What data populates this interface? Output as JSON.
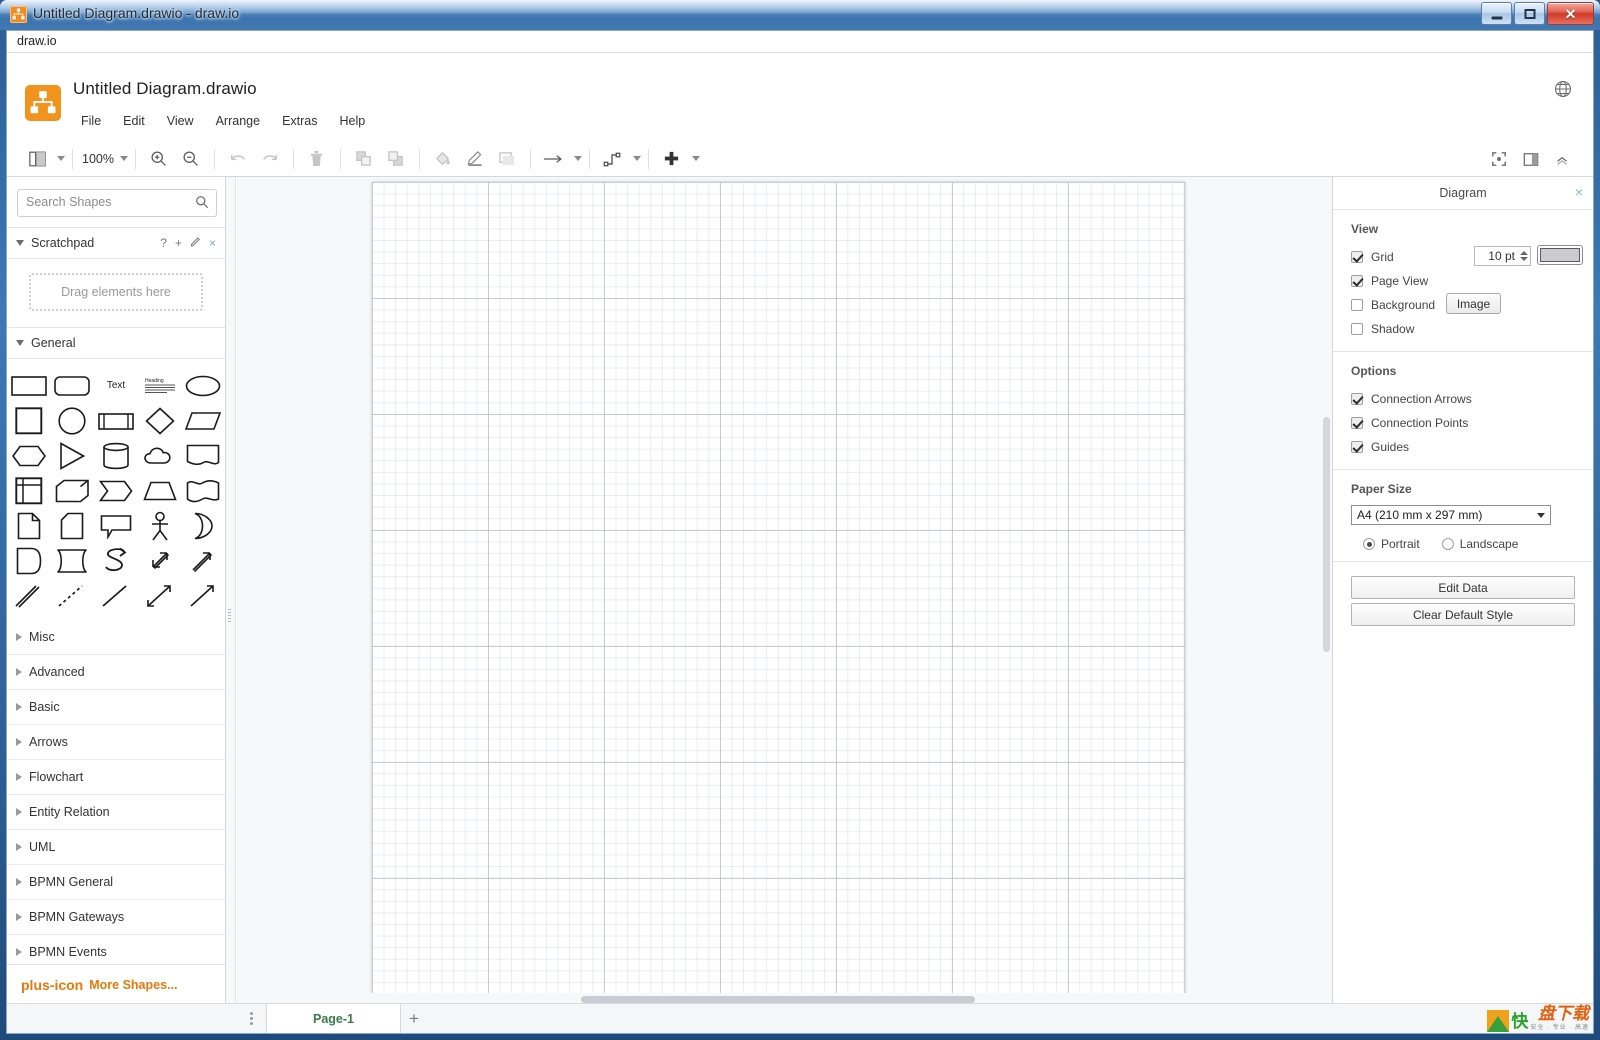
{
  "window": {
    "title": "Untitled Diagram.drawio - draw.io",
    "minimize_label": "Minimize",
    "maximize_label": "Maximize",
    "close_label": "✕"
  },
  "menustrip": {
    "label": "draw.io"
  },
  "header": {
    "app_title": "Untitled Diagram.drawio",
    "menus": [
      "File",
      "Edit",
      "View",
      "Arrange",
      "Extras",
      "Help"
    ],
    "language_icon": "globe-icon"
  },
  "toolbar": {
    "view_layers_icon": "view-layout-icon",
    "zoom_value": "100%",
    "zoom_in_icon": "zoom-in-icon",
    "zoom_out_icon": "zoom-out-icon",
    "undo_icon": "undo-icon",
    "redo_icon": "redo-icon",
    "delete_icon": "trash-icon",
    "to_front_icon": "bring-to-front-icon",
    "to_back_icon": "send-to-back-icon",
    "fill_icon": "fill-color-icon",
    "line_icon": "line-color-icon",
    "shadow_icon": "shadow-icon",
    "connection_icon": "connection-arrow-icon",
    "waypoints_icon": "waypoints-icon",
    "insert_icon": "insert-plus-icon",
    "fullscreen_icon": "fullscreen-icon",
    "format_panel_icon": "format-panel-icon",
    "collapse_icon": "collapse-chevrons-icon"
  },
  "sidebar": {
    "search": {
      "placeholder": "Search Shapes",
      "value": "",
      "icon": "search-icon"
    },
    "scratchpad": {
      "title": "Scratchpad",
      "help_icon": "?",
      "add_icon": "+",
      "edit_icon": "pencil-icon",
      "close_icon": "×",
      "dropzone_text": "Drag elements here"
    },
    "general": {
      "title": "General",
      "shapes": [
        "rectangle",
        "rounded-rectangle",
        "text",
        "textbox",
        "ellipse",
        "square",
        "circle",
        "process",
        "diamond",
        "parallelogram",
        "hexagon",
        "triangle",
        "cylinder",
        "cloud",
        "document",
        "internal-storage",
        "cube",
        "step",
        "trapezoid",
        "tape",
        "note",
        "card",
        "callout",
        "actor",
        "or",
        "data-storage",
        "delay",
        "s-curve",
        "double-arrow",
        "single-arrow",
        "double-line",
        "dashed-line",
        "line",
        "bidirectional-arrow",
        "arrow"
      ],
      "shapes_label_text": "Text",
      "shapes_label_textbox": "Heading"
    },
    "categories": [
      "Misc",
      "Advanced",
      "Basic",
      "Arrows",
      "Flowchart",
      "Entity Relation",
      "UML",
      "BPMN General",
      "BPMN Gateways",
      "BPMN Events"
    ],
    "more_shapes": "More Shapes...",
    "more_shapes_icon": "plus-icon"
  },
  "format_panel": {
    "title": "Diagram",
    "close_icon": "×",
    "view": {
      "heading": "View",
      "grid": {
        "label": "Grid",
        "checked": true,
        "size_value": "10 pt",
        "color": "#ccccd0"
      },
      "page_view": {
        "label": "Page View",
        "checked": true
      },
      "background": {
        "label": "Background",
        "checked": false,
        "button": "Image"
      },
      "shadow": {
        "label": "Shadow",
        "checked": false
      }
    },
    "options": {
      "heading": "Options",
      "items": [
        {
          "label": "Connection Arrows",
          "checked": true
        },
        {
          "label": "Connection Points",
          "checked": true
        },
        {
          "label": "Guides",
          "checked": true
        }
      ]
    },
    "paper": {
      "heading": "Paper Size",
      "selected": "A4 (210 mm x 297 mm)",
      "orientation": [
        {
          "label": "Portrait",
          "selected": true
        },
        {
          "label": "Landscape",
          "selected": false
        }
      ]
    },
    "buttons": [
      "Edit Data",
      "Clear Default Style"
    ]
  },
  "bottom": {
    "page_menu_icon": "vertical-dots-icon",
    "page_tab": "Page-1",
    "add_page_icon": "+",
    "watermark": {
      "main": "快",
      "accent": "盘下载",
      "sub": "安全 · 专业 · 高速"
    }
  },
  "colors": {
    "accent_orange": "#f2931d",
    "page_tab_green": "#3a7a46",
    "more_shapes_orange": "#e8780a",
    "link_blue": "#8fb3d6"
  }
}
